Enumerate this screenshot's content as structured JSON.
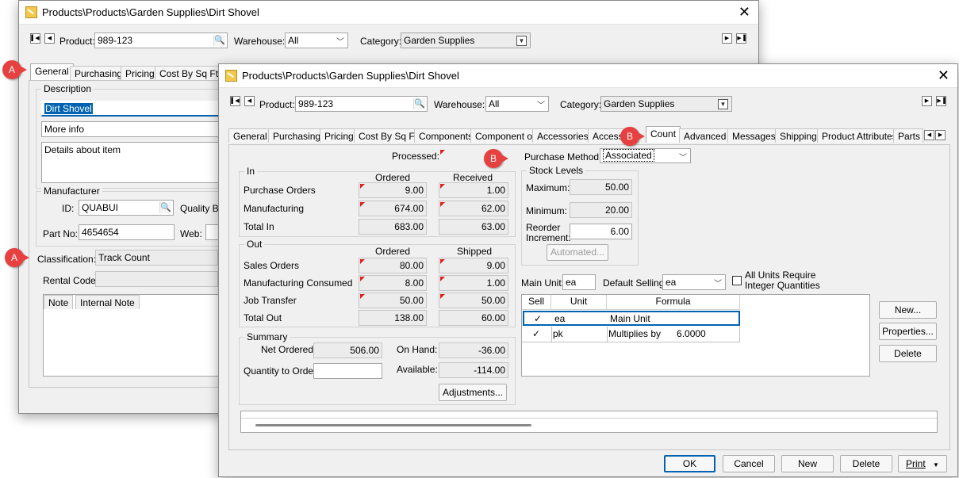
{
  "back_window": {
    "title": "Products\\Products\\Garden Supplies\\Dirt Shovel",
    "product_label": "Product:",
    "product_value": "989-123",
    "warehouse_label": "Warehouse:",
    "warehouse_value": "All",
    "category_label": "Category:",
    "category_value": "Garden Supplies",
    "tabs": [
      "General",
      "Purchasing",
      "Pricing",
      "Cost By Sq Ft"
    ],
    "description_group": "Description",
    "description_value": "Dirt Shovel",
    "more_info": "More info",
    "details": "Details about item",
    "manufacturer_group": "Manufacturer",
    "id_label": "ID:",
    "id_value": "QUABUI",
    "quality_label": "Quality Bu",
    "partno_label": "Part No:",
    "partno_value": "4654654",
    "web_label": "Web:",
    "classification_label": "Classification:",
    "classification_value": "Track Count",
    "rental_label": "Rental Code:",
    "note_tabs": [
      "Note",
      "Internal Note"
    ]
  },
  "front_window": {
    "title": "Products\\Products\\Garden Supplies\\Dirt Shovel",
    "product_label": "Product:",
    "product_value": "989-123",
    "warehouse_label": "Warehouse:",
    "warehouse_value": "All",
    "category_label": "Category:",
    "category_value": "Garden Supplies",
    "tabs": [
      "General",
      "Purchasing",
      "Pricing",
      "Cost By Sq Ft",
      "Components",
      "Component of",
      "Accessories",
      "Access",
      "Count",
      "Advanced",
      "Messages",
      "Shipping",
      "Product Attributes",
      "Parts C"
    ],
    "processed_label": "Processed:",
    "purchase_method_label": "Purchase Method:",
    "purchase_method_value": "Associated",
    "in_group": {
      "title": "In",
      "col1": "Ordered",
      "col2": "Received",
      "rows": [
        {
          "label": "Purchase Orders",
          "a": "9.00",
          "b": "1.00"
        },
        {
          "label": "Manufacturing",
          "a": "674.00",
          "b": "62.00"
        },
        {
          "label": "Total In",
          "a": "683.00",
          "b": "63.00"
        }
      ]
    },
    "out_group": {
      "title": "Out",
      "col1": "Ordered",
      "col2": "Shipped",
      "rows": [
        {
          "label": "Sales Orders",
          "a": "80.00",
          "b": "9.00"
        },
        {
          "label": "Manufacturing Consumed",
          "a": "8.00",
          "b": "1.00"
        },
        {
          "label": "Job Transfer",
          "a": "50.00",
          "b": "50.00"
        },
        {
          "label": "Total Out",
          "a": "138.00",
          "b": "60.00"
        }
      ]
    },
    "summary_group": {
      "title": "Summary",
      "net_ordered_label": "Net Ordered:",
      "net_ordered_value": "506.00",
      "on_hand_label": "On Hand:",
      "on_hand_value": "-36.00",
      "qty_to_order_label": "Quantity to Order:",
      "available_label": "Available:",
      "available_value": "-114.00",
      "adjustments": "Adjustments..."
    },
    "stock_levels": {
      "title": "Stock Levels",
      "maximum_label": "Maximum:",
      "maximum_value": "50.00",
      "minimum_label": "Minimum:",
      "minimum_value": "20.00",
      "reorder_label_1": "Reorder",
      "reorder_label_2": "Increment:",
      "reorder_value": "6.00",
      "automated": "Automated..."
    },
    "main_unit_label": "Main Unit:",
    "main_unit_value": "ea",
    "default_selling_label": "Default Selling:",
    "default_selling_value": "ea",
    "all_units_label_1": "All Units Require",
    "all_units_label_2": "Integer Quantities",
    "units_table": {
      "headers": [
        "Sell",
        "Unit",
        "Formula"
      ],
      "rows": [
        {
          "sell": "✓",
          "unit": "ea",
          "formula": "Main Unit"
        },
        {
          "sell": "✓",
          "unit": "pk",
          "formula": "Multiplies by      6.0000"
        }
      ]
    },
    "unit_buttons": [
      "New...",
      "Properties...",
      "Delete"
    ],
    "footer_buttons": [
      "OK",
      "Cancel",
      "New",
      "Delete",
      "Print"
    ]
  },
  "badges": [
    "A",
    "A",
    "B",
    "B"
  ],
  "colors": {
    "badge": "#e64040",
    "selection": "#0063b1"
  }
}
